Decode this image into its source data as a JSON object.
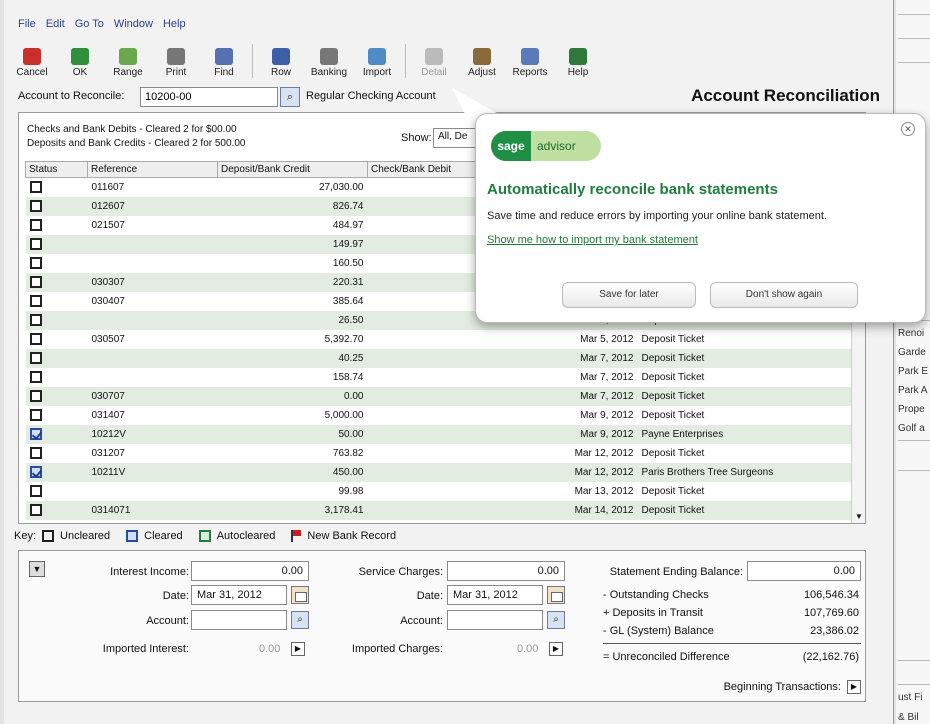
{
  "menu": [
    "File",
    "Edit",
    "Go To",
    "Window",
    "Help"
  ],
  "toolbar": [
    {
      "label": "Cancel",
      "icon": "cancel-icon",
      "color": "#c9302c"
    },
    {
      "label": "OK",
      "icon": "ok-check-icon",
      "color": "#2f8f3a"
    },
    {
      "label": "Range",
      "icon": "range-icon",
      "color": "#6aa84f"
    },
    {
      "label": "Print",
      "icon": "printer-icon",
      "color": "#777777"
    },
    {
      "label": "Find",
      "icon": "find-icon",
      "color": "#5570b0"
    },
    {
      "label": "Row",
      "icon": "row-icon",
      "color": "#3b5fa8"
    },
    {
      "label": "Banking",
      "icon": "banking-icon",
      "color": "#777777"
    },
    {
      "label": "Import",
      "icon": "import-icon",
      "color": "#4f8bc4"
    },
    {
      "label": "Detail",
      "icon": "detail-icon",
      "color": "#bbbbbb"
    },
    {
      "label": "Adjust",
      "icon": "adjust-icon",
      "color": "#8a6a3a"
    },
    {
      "label": "Reports",
      "icon": "reports-icon",
      "color": "#5b7bb8"
    },
    {
      "label": "Help",
      "icon": "help-icon",
      "color": "#2f7a3a"
    }
  ],
  "account": {
    "label": "Account to Reconcile:",
    "value": "10200-00",
    "name": "Regular Checking Account",
    "title": "Account Reconciliation"
  },
  "summary": {
    "checks": "Checks and Bank Debits -   Cleared 2 for $00.00",
    "deposits": "Deposits and Bank Credits - Cleared 2 for 500.00",
    "show_label": "Show:",
    "show_value": "All, De"
  },
  "columns": [
    "Status",
    "Reference",
    "Deposit/Bank Credit",
    "Check/Bank Debit",
    "Date",
    "Description"
  ],
  "rows": [
    {
      "cleared": false,
      "ref": "011607",
      "amount": "27,030.00",
      "date": "",
      "desc": ""
    },
    {
      "cleared": false,
      "ref": "012607",
      "amount": "826.74",
      "date": "",
      "desc": ""
    },
    {
      "cleared": false,
      "ref": "021507",
      "amount": "484.97",
      "date": "",
      "desc": ""
    },
    {
      "cleared": false,
      "ref": "",
      "amount": "149.97",
      "date": "",
      "desc": ""
    },
    {
      "cleared": false,
      "ref": "",
      "amount": "160.50",
      "date": "",
      "desc": ""
    },
    {
      "cleared": false,
      "ref": "030307",
      "amount": "220.31",
      "date": "",
      "desc": ""
    },
    {
      "cleared": false,
      "ref": "030407",
      "amount": "385.64",
      "date": "",
      "desc": ""
    },
    {
      "cleared": false,
      "ref": "",
      "amount": "26.50",
      "date": "Mar 5, 2012",
      "desc": "Deposit Ticket"
    },
    {
      "cleared": false,
      "ref": "030507",
      "amount": "5,392.70",
      "date": "Mar 5, 2012",
      "desc": "Deposit Ticket"
    },
    {
      "cleared": false,
      "ref": "",
      "amount": "40.25",
      "date": "Mar 7, 2012",
      "desc": "Deposit Ticket"
    },
    {
      "cleared": false,
      "ref": "",
      "amount": "158.74",
      "date": "Mar 7, 2012",
      "desc": "Deposit Ticket"
    },
    {
      "cleared": false,
      "ref": "030707",
      "amount": "0.00",
      "date": "Mar 7, 2012",
      "desc": "Deposit Ticket"
    },
    {
      "cleared": false,
      "ref": "031407",
      "amount": "5,000.00",
      "date": "Mar 9, 2012",
      "desc": "Deposit Ticket"
    },
    {
      "cleared": true,
      "ref": "10212V",
      "amount": "50.00",
      "date": "Mar 9, 2012",
      "desc": "Payne Enterprises"
    },
    {
      "cleared": false,
      "ref": "031207",
      "amount": "763.82",
      "date": "Mar 12, 2012",
      "desc": "Deposit Ticket"
    },
    {
      "cleared": true,
      "ref": "10211V",
      "amount": "450.00",
      "date": "Mar 12, 2012",
      "desc": "Paris Brothers Tree Surgeons"
    },
    {
      "cleared": false,
      "ref": "",
      "amount": "99.98",
      "date": "Mar 13, 2012",
      "desc": "Deposit Ticket"
    },
    {
      "cleared": false,
      "ref": "0314071",
      "amount": "3,178.41",
      "date": "Mar 14, 2012",
      "desc": "Deposit Ticket"
    }
  ],
  "key": {
    "prefix": "Key:",
    "uncleared": "Uncleared",
    "cleared": "Cleared",
    "autocleared": "Autocleared",
    "newbank": "New Bank Record"
  },
  "bottom": {
    "interest_label": "Interest Income:",
    "interest_value": "0.00",
    "date_label": "Date:",
    "date_value": "Mar 31, 2012",
    "account_label": "Account:",
    "account_value": "",
    "imported_interest_label": "Imported Interest:",
    "imported_interest_value": "0.00",
    "service_label": "Service Charges:",
    "service_value": "0.00",
    "sdate_label": "Date:",
    "sdate_value": "Mar 31, 2012",
    "saccount_label": "Account:",
    "saccount_value": "",
    "imported_charges_label": "Imported Charges:",
    "imported_charges_value": "0.00",
    "ending_label": "Statement Ending Balance:",
    "ending_value": "0.00",
    "outstanding_label": "- Outstanding Checks",
    "outstanding_value": "106,546.34",
    "transit_label": "+ Deposits in Transit",
    "transit_value": "107,769.60",
    "gl_label": "- GL (System) Balance",
    "gl_value": "23,386.02",
    "unrec_label": "= Unreconciled Difference",
    "unrec_value": "(22,162.76)",
    "beginning_label": "Beginning Transactions:"
  },
  "popup": {
    "brand": "sage",
    "brand2": "advisor",
    "heading": "Automatically reconcile bank statements",
    "body": "Save time and reduce errors by importing your online bank statement.",
    "link": "Show me how to import my bank statement",
    "save_later": "Save for later",
    "dont_show": "Don't show again"
  },
  "side": [
    "Renoi",
    "Garde",
    "Park E",
    "Park A",
    "Prope",
    "Golf a",
    "ust Fi",
    "& Bil"
  ]
}
